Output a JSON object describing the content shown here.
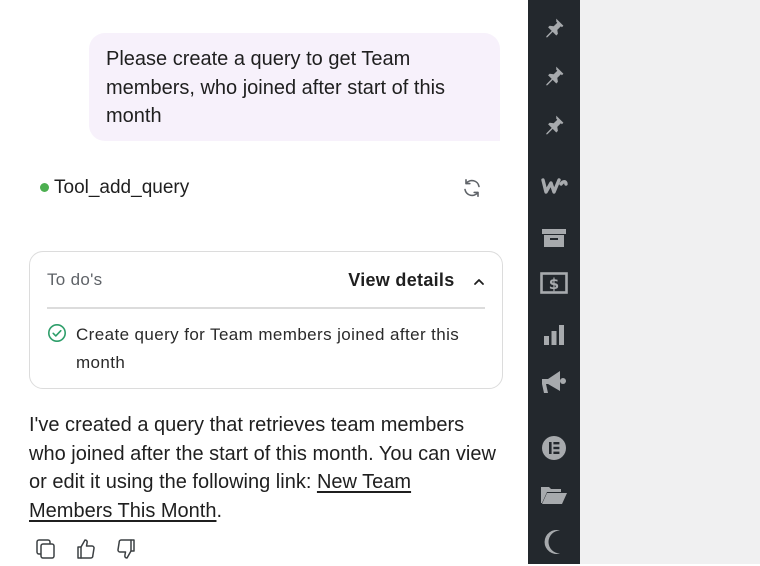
{
  "user_message": {
    "text": "Please create a query to get Team members, who joined after start of this month"
  },
  "tool_call": {
    "name": "Tool_add_query",
    "status_color": "#4caf50"
  },
  "todo": {
    "title": "To do's",
    "view_details_label": "View details",
    "items": [
      {
        "text": "Create query for Team members joined after this month",
        "done": true
      }
    ]
  },
  "assistant_message": {
    "text_before_link": "I've created a query that retrieves team members who joined after the start of this month. You can view or edit it using the following link: ",
    "link_text": "New Team Members This Month",
    "text_after_link": "."
  },
  "actions": [
    "copy-icon",
    "thumbs-up-icon",
    "thumbs-down-icon"
  ],
  "sidebar": {
    "background": "#23282d",
    "icons": [
      "pin-icon",
      "pin-icon",
      "pin-icon",
      "woocommerce-icon",
      "archive-icon",
      "money-icon",
      "bar-chart-icon",
      "megaphone-icon",
      "elementor-icon",
      "folder-icon",
      "moon-icon"
    ]
  },
  "colors": {
    "user_bubble": "#f7f1fb",
    "check_green": "#2e9e6a",
    "panel_gray": "#f0f0f1"
  }
}
